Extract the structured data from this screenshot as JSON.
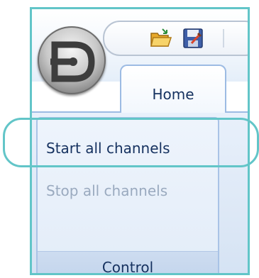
{
  "ribbon": {
    "tab_label": "Home",
    "commands": [
      {
        "label": "Start all channels",
        "enabled": true
      },
      {
        "label": "Stop all channels",
        "enabled": false
      }
    ],
    "group_label": "Control"
  },
  "quick_access": {
    "icons": [
      "open-folder-icon",
      "save-icon",
      "customize-dropdown-icon"
    ]
  },
  "app_button": {
    "icon": "app-logo-d-icon"
  },
  "colors": {
    "highlight": "#62c5c8",
    "text": "#15315f",
    "disabled_text": "#9aaabf",
    "panel": "#dde8f6"
  }
}
